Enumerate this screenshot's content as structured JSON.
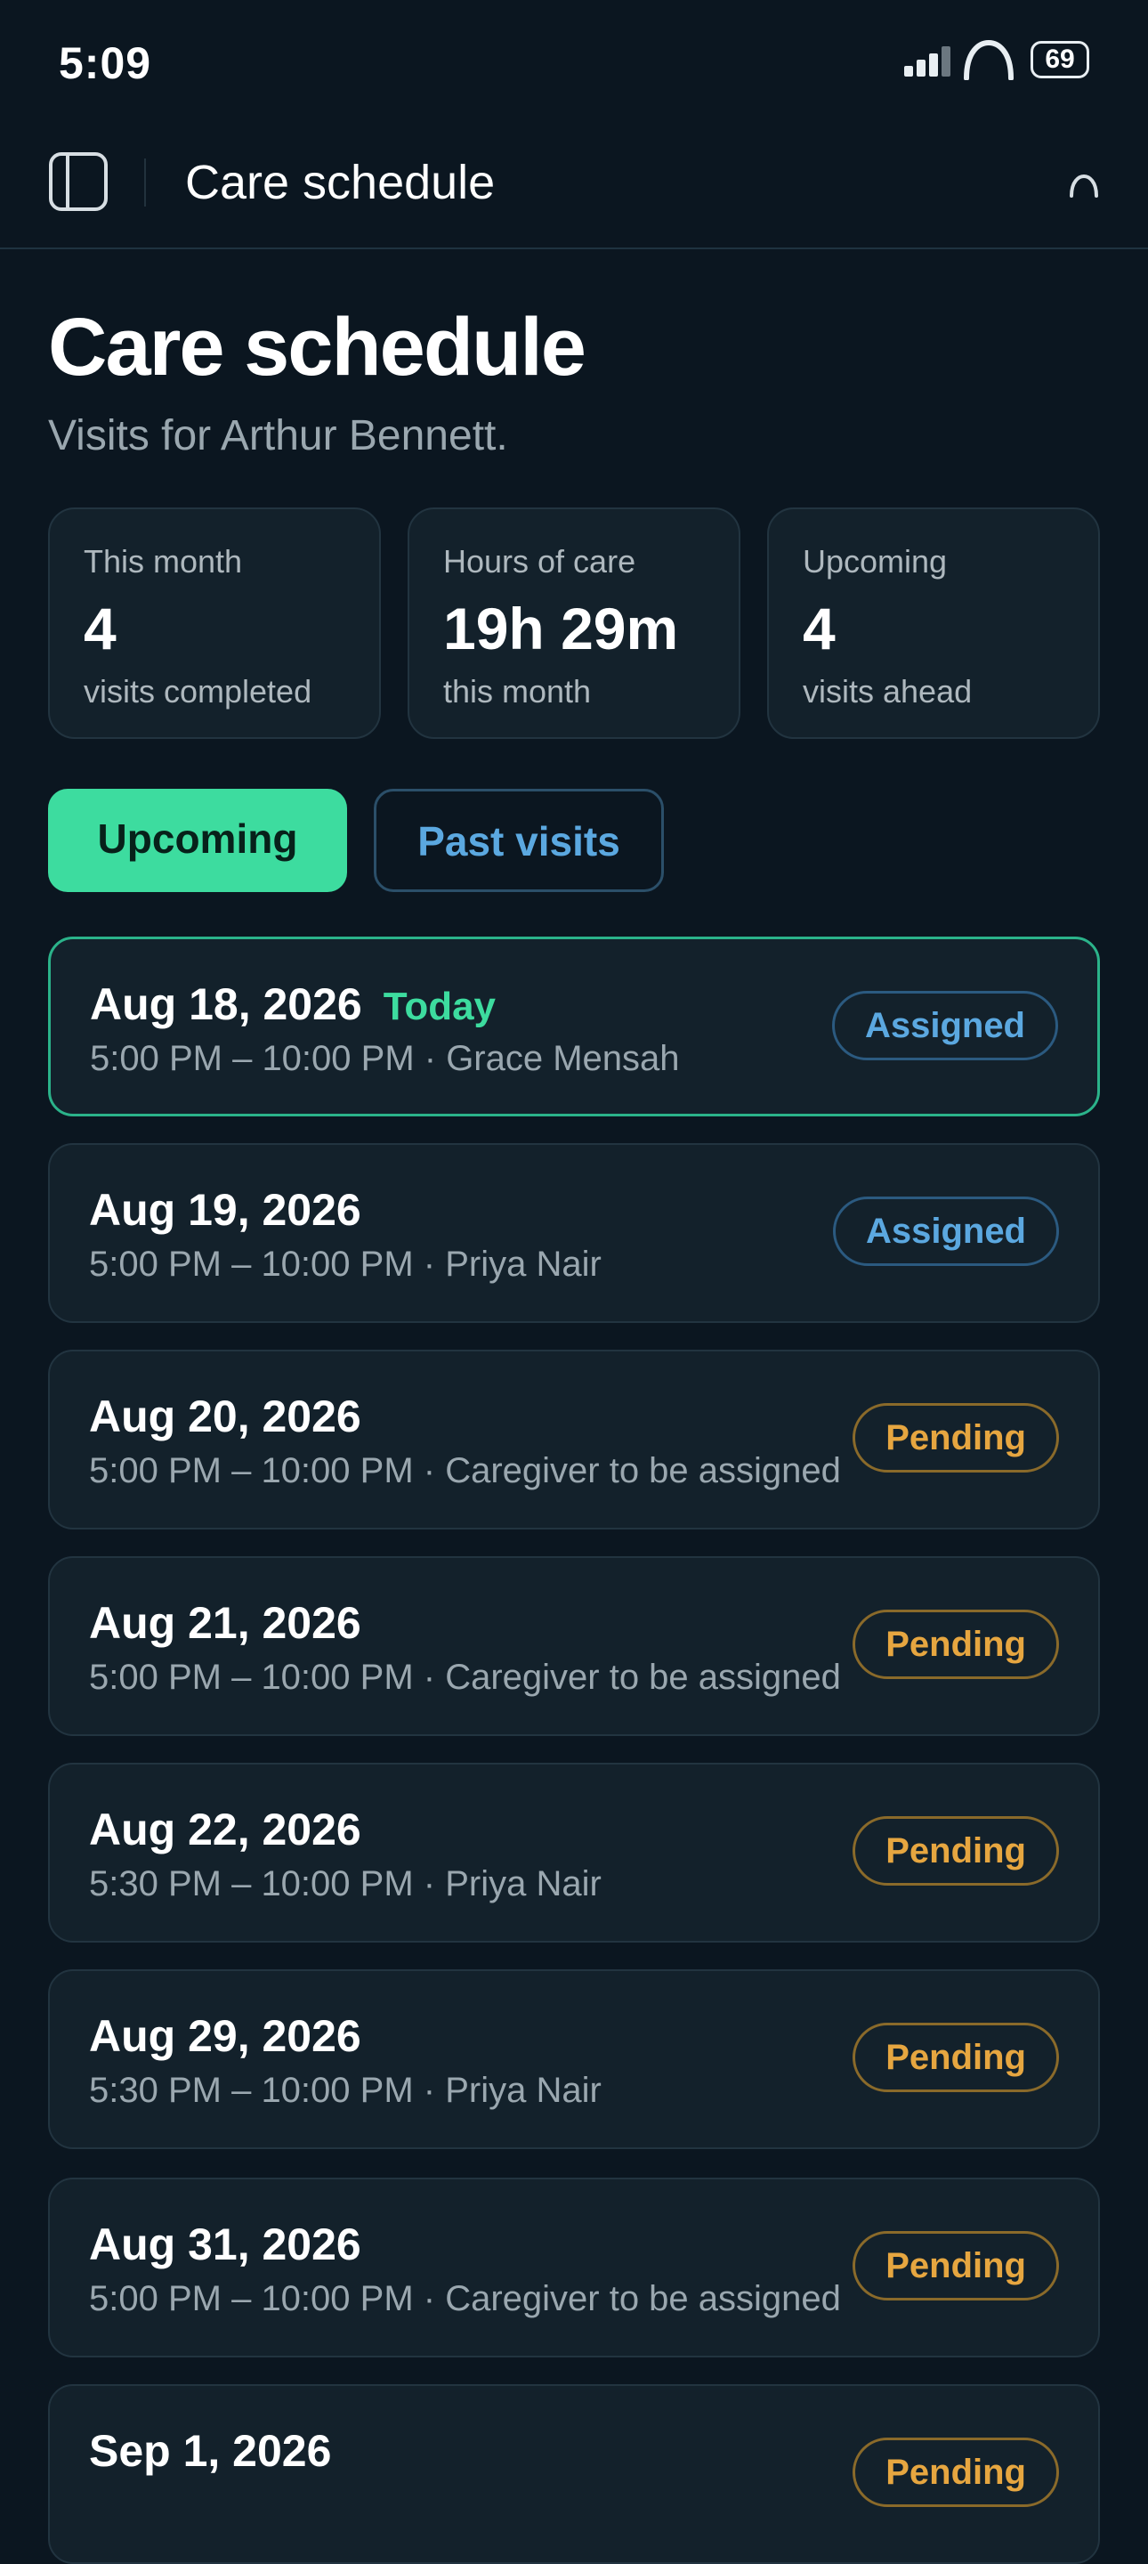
{
  "status_bar": {
    "time": "5:09",
    "battery": "69"
  },
  "app_bar": {
    "title": "Care schedule"
  },
  "header": {
    "title": "Care schedule",
    "subtitle": "Visits for Arthur Bennett."
  },
  "stats": [
    {
      "label": "This month",
      "value": "4",
      "caption": "visits completed"
    },
    {
      "label": "Hours of care",
      "value": "19h 29m",
      "caption": "this month"
    },
    {
      "label": "Upcoming",
      "value": "4",
      "caption": "visits ahead"
    }
  ],
  "tabs": [
    {
      "label": "Upcoming",
      "active": true
    },
    {
      "label": "Past visits",
      "active": false
    }
  ],
  "visits": [
    {
      "date": "Aug 18, 2026",
      "today_label": "Today",
      "meta": "5:00 PM – 10:00 PM · Grace Mensah",
      "status": "Assigned"
    },
    {
      "date": "Aug 19, 2026",
      "today_label": "",
      "meta": "5:00 PM – 10:00 PM · Priya Nair",
      "status": "Assigned"
    },
    {
      "date": "Aug 20, 2026",
      "today_label": "",
      "meta": "5:00 PM – 10:00 PM · Caregiver to be assigned",
      "status": "Pending"
    },
    {
      "date": "Aug 21, 2026",
      "today_label": "",
      "meta": "5:00 PM – 10:00 PM · Caregiver to be assigned",
      "status": "Pending"
    },
    {
      "date": "Aug 22, 2026",
      "today_label": "",
      "meta": "5:30 PM – 10:00 PM · Priya Nair",
      "status": "Pending"
    },
    {
      "date": "Aug 29, 2026",
      "today_label": "",
      "meta": "5:30 PM – 10:00 PM · Priya Nair",
      "status": "Pending"
    },
    {
      "date": "Aug 31, 2026",
      "today_label": "",
      "meta": "5:00 PM – 10:00 PM · Caregiver to be assigned",
      "status": "Pending"
    },
    {
      "date": "Sep 1, 2026",
      "today_label": "",
      "meta": "",
      "status": "Pending"
    }
  ],
  "colors": {
    "background": "#0b1620",
    "card": "#13212b",
    "accent_green": "#3ddc9f",
    "assigned_blue": "#5ba8e0",
    "pending_amber": "#e6a640"
  }
}
